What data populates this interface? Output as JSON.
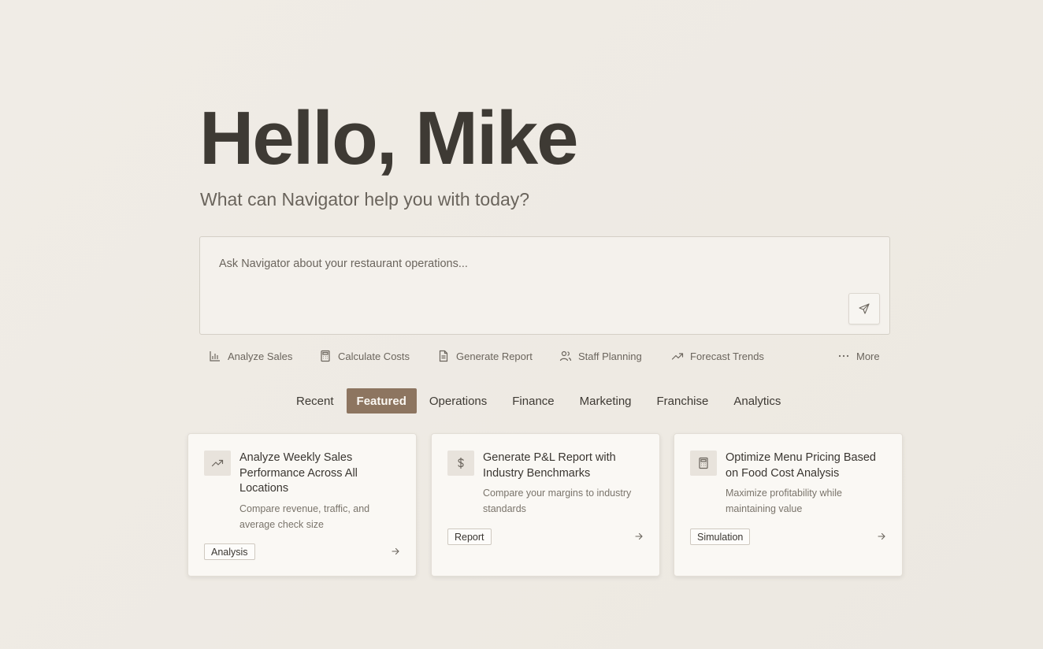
{
  "header": {
    "greeting": "Hello, Mike",
    "subtitle": "What can Navigator help you with today?"
  },
  "prompt": {
    "placeholder": "Ask Navigator about your restaurant operations..."
  },
  "quick_actions": [
    {
      "label": "Analyze Sales",
      "icon": "bar-chart-icon"
    },
    {
      "label": "Calculate Costs",
      "icon": "calculator-icon"
    },
    {
      "label": "Generate Report",
      "icon": "document-icon"
    },
    {
      "label": "Staff Planning",
      "icon": "users-icon"
    },
    {
      "label": "Forecast Trends",
      "icon": "trend-up-icon"
    },
    {
      "label": "More",
      "icon": "ellipsis-icon"
    }
  ],
  "tabs": [
    {
      "label": "Recent"
    },
    {
      "label": "Featured",
      "active": true
    },
    {
      "label": "Operations"
    },
    {
      "label": "Finance"
    },
    {
      "label": "Marketing"
    },
    {
      "label": "Franchise"
    },
    {
      "label": "Analytics"
    }
  ],
  "cards": [
    {
      "icon": "trend-up-icon",
      "title": "Analyze Weekly Sales Performance Across All Locations",
      "description": "Compare revenue, traffic, and average check size",
      "tag": "Analysis"
    },
    {
      "icon": "dollar-icon",
      "title": "Generate P&L Report with Industry Benchmarks",
      "description": "Compare your margins to industry standards",
      "tag": "Report"
    },
    {
      "icon": "calculator-icon",
      "title": "Optimize Menu Pricing Based on Food Cost Analysis",
      "description": "Maximize profitability while maintaining value",
      "tag": "Simulation"
    }
  ],
  "colors": {
    "background": "#efebe4",
    "accent": "#8d7560",
    "text": "#3e3a34"
  }
}
